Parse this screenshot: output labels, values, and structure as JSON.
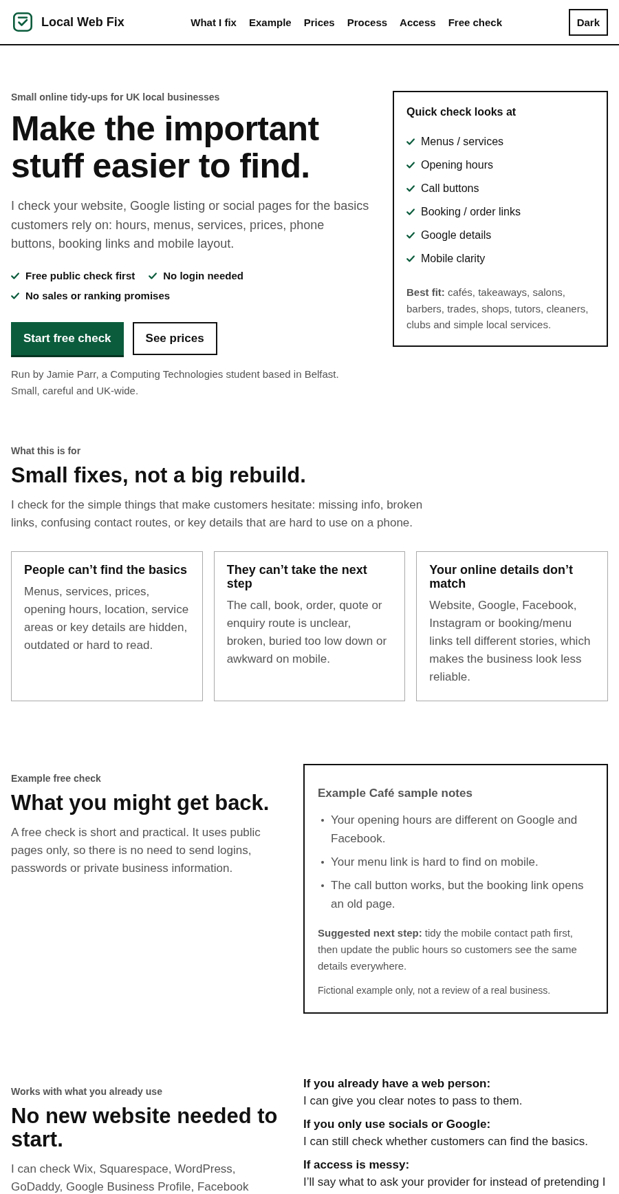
{
  "header": {
    "brand": "Local Web Fix",
    "nav": [
      {
        "label": "What I fix"
      },
      {
        "label": "Example"
      },
      {
        "label": "Prices"
      },
      {
        "label": "Process"
      },
      {
        "label": "Access"
      },
      {
        "label": "Free check"
      }
    ],
    "theme_button": "Dark"
  },
  "hero": {
    "eyebrow": "Small online tidy-ups for UK local businesses",
    "title": "Make the important stuff easier to find.",
    "intro": "I check your website, Google listing or social pages for the basics customers rely on: hours, menus, services, prices, phone buttons, booking links and mobile layout.",
    "highlights": [
      "Free public check first",
      "No login needed",
      "No sales or ranking promises"
    ],
    "buttons": [
      {
        "label": "Start free check",
        "kind": "primary"
      },
      {
        "label": "See prices",
        "kind": "secondary"
      }
    ],
    "note": "Run by Jamie Parr, a Computing Technologies student based in Belfast. Small, careful and UK-wide."
  },
  "quick_check": {
    "title": "Quick check looks at",
    "items": [
      "Menus / services",
      "Opening hours",
      "Call buttons",
      "Booking / order links",
      "Google details",
      "Mobile clarity"
    ],
    "best_fit": "**Best fit:** cafés, takeaways, salons, barbers, trades, shops, tutors, cleaners, clubs and simple local services."
  },
  "purpose": {
    "eyebrow": "What this is for",
    "title": "Small fixes, not a big rebuild.",
    "text": "I check for the simple things that make customers hesitate: missing info, broken links, confusing contact routes, or key details that are hard to use on a phone.",
    "cards": [
      {
        "title": "People can’t find the basics",
        "text": "Menus, services, prices, opening hours, location, service areas or key details are hidden, outdated or hard to read."
      },
      {
        "title": "They can’t take the next step",
        "text": "The call, book, order, quote or enquiry route is unclear, broken, buried too low down or awkward on mobile."
      },
      {
        "title": "Your online details don’t match",
        "text": "Website, Google, Facebook, Instagram or booking/menu links tell different stories, which makes the business look less reliable."
      }
    ]
  },
  "example": {
    "eyebrow": "Example free check",
    "title": "What you might get back.",
    "text": "A free check is short and practical. It uses public pages only, so there is no need to send logins, passwords or private business information.",
    "sample": {
      "title": "Example Café sample notes",
      "notes": [
        "Your opening hours are different on Google and Facebook.",
        "Your menu link is hard to find on mobile.",
        "The call button works, but the booking link opens an old page."
      ],
      "next_step": "**Suggested next step:** tidy the mobile contact path first, then update the public hours so customers see the same details everywhere.",
      "disclaimer": "Fictional example only, not a review of a real business."
    }
  },
  "tools": {
    "eyebrow": "Works with what you already use",
    "title": "No new website needed to start.",
    "text": "I can check Wix, Squarespace, WordPress, GoDaddy, Google Business Profile, Facebook",
    "cases": [
      {
        "question": "If you already have a web person:",
        "answer": "I can give you clear notes to pass to them."
      },
      {
        "question": "If you only use socials or Google:",
        "answer": "I can still check whether customers can find the basics."
      },
      {
        "question": "If access is messy:",
        "answer": "I’ll say what to ask your provider for instead of pretending I"
      }
    ]
  }
}
